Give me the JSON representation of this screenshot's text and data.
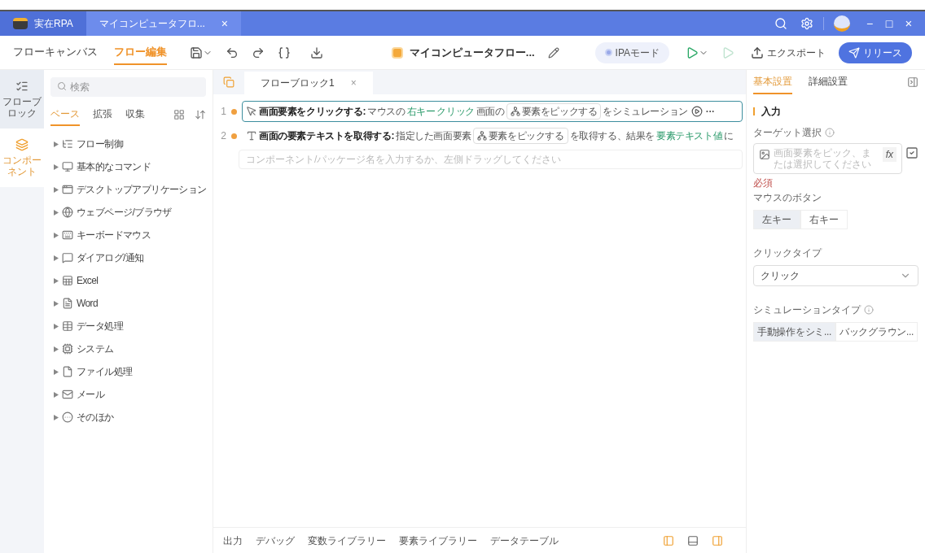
{
  "window": {
    "tabs": [
      {
        "label": "実在RPA",
        "selected": false,
        "kind": "app"
      },
      {
        "label": "マイコンピュータフロ...",
        "selected": true,
        "kind": "doc",
        "close": "×"
      }
    ],
    "controls": {
      "minimize": "−",
      "maximize": "□",
      "close": "×"
    }
  },
  "toolbar": {
    "views": [
      {
        "label": "フローキャンバス",
        "selected": false
      },
      {
        "label": "フロー編集",
        "selected": true
      }
    ],
    "flow_name": "マイコンピュータフロー...",
    "mode": "IPAモード",
    "export": "エクスポート",
    "release": "リリース"
  },
  "rail": [
    {
      "label": "フローブロック",
      "selected": false
    },
    {
      "label": "コンポーネント",
      "selected": true
    }
  ],
  "library": {
    "search": {
      "placeholder": "検索"
    },
    "tabs": [
      {
        "label": "ベース",
        "selected": true
      },
      {
        "label": "拡張",
        "selected": false
      },
      {
        "label": "収集",
        "selected": false
      }
    ],
    "categories": [
      "フロー制御",
      "基本的なコマンド",
      "デスクトップアプリケーション",
      "ウェブページ/ブラウザ",
      "キーボードマウス",
      "ダイアログ/通知",
      "Excel",
      "Word",
      "データ処理",
      "システム",
      "ファイル処理",
      "メール",
      "そのほか"
    ]
  },
  "editor": {
    "tab": {
      "label": "フローブロック1",
      "close": "×"
    },
    "steps": [
      {
        "number": "1",
        "selected": true,
        "segments": [
          {
            "kind": "title",
            "text": "画面要素をクリックする:"
          },
          {
            "kind": "text",
            "text": "マウスの"
          },
          {
            "kind": "var",
            "text": "右キー"
          },
          {
            "kind": "var",
            "text": "クリック"
          },
          {
            "kind": "text",
            "text": "画面の"
          },
          {
            "kind": "pick",
            "text": "要素をピックする"
          },
          {
            "kind": "text",
            "text": "をシミュレーション"
          }
        ],
        "more": "···"
      },
      {
        "number": "2",
        "selected": false,
        "segments": [
          {
            "kind": "title",
            "text": "画面の要素テキストを取得する:"
          },
          {
            "kind": "text",
            "text": "指定した画面要素"
          },
          {
            "kind": "pick",
            "text": "要素をピックする"
          },
          {
            "kind": "text",
            "text": "を取得する、結果を"
          },
          {
            "kind": "var",
            "text": "要素テキスト値"
          },
          {
            "kind": "text",
            "text": "に"
          }
        ]
      }
    ],
    "add_placeholder": "コンポーネント/パッケージ名を入力するか、左側ドラッグしてください",
    "bottom_tabs": [
      "出力",
      "デバッグ",
      "変数ライブラリー",
      "要素ライブラリー",
      "データテーブル"
    ]
  },
  "properties": {
    "tabs": [
      {
        "label": "基本設置",
        "selected": true
      },
      {
        "label": "詳細設置",
        "selected": false
      }
    ],
    "section": "入力",
    "target": {
      "label": "ターゲット選択",
      "placeholder": "画面要素をピック、または選択してください",
      "fx": "fx",
      "required": "必須"
    },
    "mouse_button": {
      "label": "マウスのボタン",
      "options": [
        {
          "label": "左キー",
          "selected": true
        },
        {
          "label": "右キー",
          "selected": false
        }
      ]
    },
    "click_type": {
      "label": "クリックタイプ",
      "value": "クリック"
    },
    "simulation_type": {
      "label": "シミュレーションタイプ",
      "options": [
        {
          "label": "手動操作をシミ...",
          "selected": true
        },
        {
          "label": "バックグラウン...",
          "selected": false
        }
      ]
    }
  }
}
